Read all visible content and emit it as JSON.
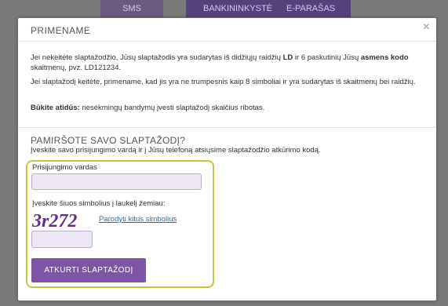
{
  "background": {
    "tabs": [
      "SMS",
      "BANKININKYSTĖ",
      "E-PARAŠAS"
    ]
  },
  "modal": {
    "title": "PRIMENAME",
    "close_glyph": "×",
    "para1": {
      "t1": "Jei nekeitėte slaptažodžio, Jūsų slaptažodis yra sudarytas iš didžiųjų raidžių ",
      "b1": "LD",
      "t2": " ir 6 paskutinių Jūsų ",
      "b2": "asmens kodo",
      "t3": " skaitmenų, pvz. LD121234."
    },
    "para2": "Jei slaptažodį keitėte, primename, kad jis yra ne trumpesnis kaip 8 simboliai ir yra sudarytas iš skaitmenų bei raidžių.",
    "para3": {
      "b": "Būkite atidūs:",
      "t": " nesėkmingų bandymų įvesti slaptažodį skaičius ribotas."
    }
  },
  "forgot": {
    "title": "PAMIRŠOTE SAVO SLAPTAŽODĮ?",
    "subtitle": "Įveskite savo prisijungimo vardą ir į Jūsų telefoną atsiųsime slaptažodžio atkūrimo kodą.",
    "username_label": "Prisijungimo vardas",
    "username_value": "",
    "captcha_label": "Įveskite šiuos simbolius į laukelį žemiau:",
    "captcha_text": "3r272",
    "captcha_link": "Parodyti kitus simbolius",
    "captcha_value": "",
    "submit_label": "ATKURTI SLAPTAŽODĮ"
  },
  "colors": {
    "accent": "#7d55a6",
    "highlight": "#c5c83a",
    "link": "#2c6fa8",
    "input_bg": "#ece7f3"
  }
}
